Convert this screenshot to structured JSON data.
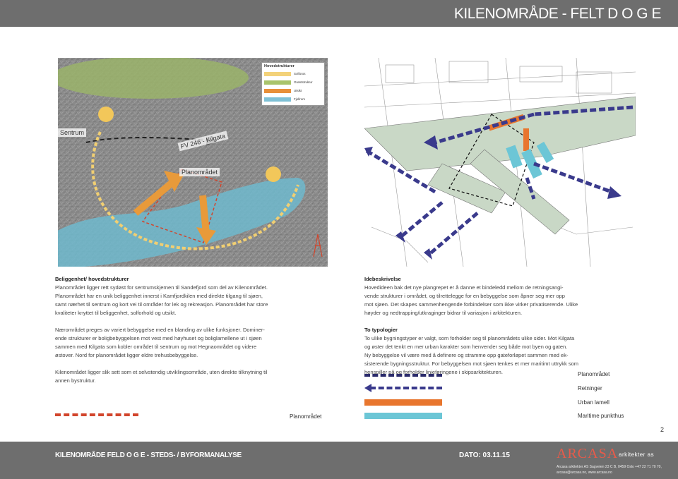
{
  "header": {
    "title": "KILENOMRÅDE - FELT D O G E"
  },
  "map_left": {
    "legend_title": "Hovedstrukturer",
    "legend": [
      {
        "label": "Solforos",
        "color": "#f3d27a"
      },
      {
        "label": "Grøntstruktur",
        "color": "#a9c46b"
      },
      {
        "label": "Utsikt",
        "color": "#e8903a"
      },
      {
        "label": "Fjellrom",
        "color": "#7fc1d6"
      }
    ],
    "label_sentrum": "Sentrum",
    "label_road": "FV 246 - Kilgata",
    "label_planomradet": "Planområdet"
  },
  "left_text": {
    "heading": "Beliggenhet/ hovedstrukturer",
    "p1": [
      "Planområdet ligger rett sydøst for sentrumskjernen til Sandefjord som del av Kilenområdet.",
      "Planområdet har en unik beliggenhet innerst i Kamfjordkilen med direkte tilgang til sjøen,",
      "samt nærhet til sentrum og kort vei til områder for lek og rekreasjon. Planområdet har store",
      "kvaliteter knyttet til beliggenhet, solforhold og utsikt."
    ],
    "p2": [
      "Nærområdet preges av variert bebyggelse med en blanding av ulike funksjoner. Dominer-",
      "ende strukturer er boligbebyggelsen mot vest med høyhuset og boliglamellene ut i sjøen",
      "sammen med Kilgata som kobler området til sentrum og mot Hegnaområdet og videre",
      "østover. Nord for planområdet ligger eldre trehusbebyggelse."
    ],
    "p3": [
      "Kilenområdet ligger slik sett som et selvstendig utviklingsområde, uten direkte tilknytning til",
      "annen bystruktur."
    ],
    "legend_label": "Planområdet"
  },
  "right_text": {
    "heading1": "Idebeskrivelse",
    "p1": [
      "Hovedideen bak det nye plangrepet er å danne et bindeledd mellom de retningsangi-",
      "vende strukturer i området, og tilrettelegge for en bebyggelse som åpner seg mer opp",
      "mot sjøen. Det skapes sammenhengende forbindelser som ikke virker privatiserende. Ulike",
      "høyder og nedtrapping/utkraginger bidrar til variasjon i arkitekturen."
    ],
    "heading2": "To typologier",
    "p2": [
      "To ulike bygningstyper er valgt, som forholder seg til planområdets ulike sider. Mot Kilgata",
      "og øster det tenkt en mer urban karakter som henvender seg både mot byen og gaten.",
      "Ny bebyggelse vil være med å definere og stramme opp gateforløpet sammen med ek-",
      "sisterende bygningsstruktur. For bebyggelsen mot sjøen tenkes et mer maritimt uttrykk som",
      "henspiller på og forholder linjeføringene i skipsarkitekturen."
    ],
    "legend": [
      {
        "label": "Planområdet",
        "color": "#2b2b6b"
      },
      {
        "label": "Retninger",
        "color": "#3a3a8c"
      },
      {
        "label": "Urban lamell",
        "color": "#e8762e"
      },
      {
        "label": "Maritime punkthus",
        "color": "#6cc6d6"
      }
    ]
  },
  "page_number": "2",
  "footer": {
    "left": "KILENOMRÅDE FELD O G E - STEDS- / BYFORMANALYSE",
    "date": "DATO: 03.11.15",
    "logo": "ARCASA",
    "logo_sub": "arkitekter as",
    "address": "Arcasa arkitekter AS Sagveien 23 C B, 0459 Oslo +47 22 71 70 70, arcasa@arcasa.no, www.arcasa.no"
  }
}
